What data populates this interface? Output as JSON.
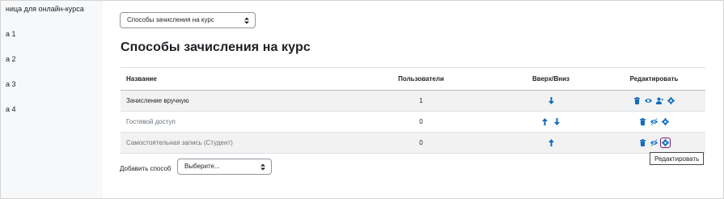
{
  "colors": {
    "accent": "#0f6cbf",
    "focus_outline": "#7a1f7a",
    "row_alt": "#f2f2f2"
  },
  "sidebar": {
    "items": [
      {
        "label": "ница для онлайн-курса"
      },
      {
        "label": "а 1"
      },
      {
        "label": "а 2"
      },
      {
        "label": "а 3"
      },
      {
        "label": "а 4"
      }
    ]
  },
  "nav_select": {
    "value": "Способы зачисления на курс",
    "icon": "chevron-updown-icon"
  },
  "page": {
    "title": "Способы зачисления на курс"
  },
  "table": {
    "headers": {
      "name": "Название",
      "users": "Пользователи",
      "updown": "Вверх/Вниз",
      "edit": "Редактировать"
    },
    "rows": [
      {
        "name": "Зачисление вручную",
        "users": "1",
        "arrows": [
          "arrow-down-icon"
        ],
        "actions": [
          "trash-icon",
          "eye-icon",
          "user-plus-icon",
          "gear-icon"
        ]
      },
      {
        "name": "Гостевой доступ",
        "users": "0",
        "arrows": [
          "arrow-up-icon",
          "arrow-down-icon"
        ],
        "actions": [
          "trash-icon",
          "eye-slash-icon",
          "gear-icon"
        ]
      },
      {
        "name": "Самостоятельная запись (Студент)",
        "users": "0",
        "arrows": [
          "arrow-up-icon"
        ],
        "actions": [
          "trash-icon",
          "eye-slash-icon",
          "gear-icon"
        ]
      }
    ]
  },
  "add_method": {
    "label": "Добавить способ",
    "select_value": "Выберите..."
  },
  "tooltip": {
    "text": "Редактировать"
  }
}
